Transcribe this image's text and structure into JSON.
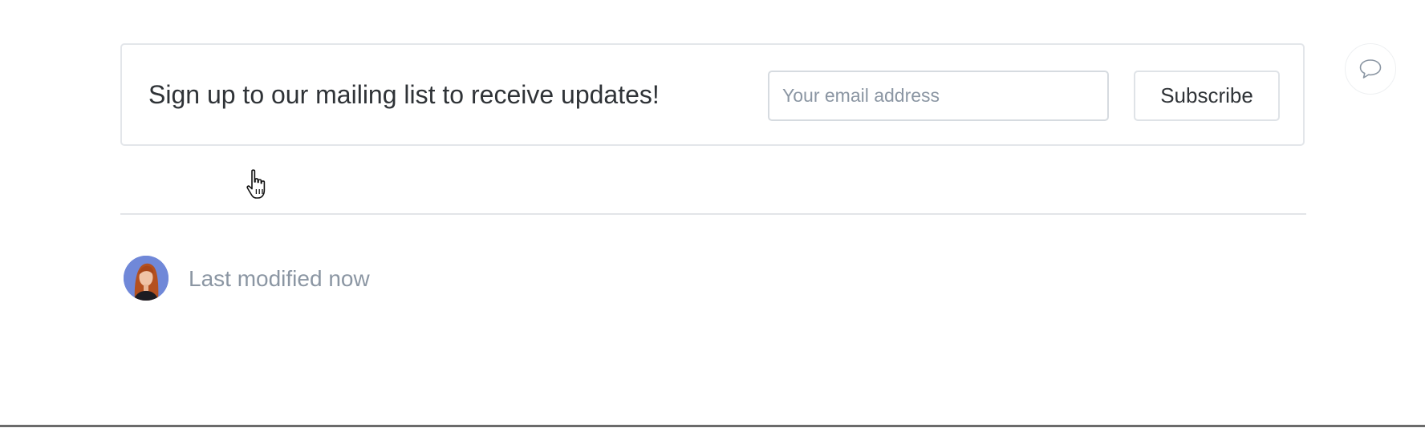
{
  "signup": {
    "heading": "Sign up to our mailing list to receive updates!",
    "email_placeholder": "Your email address",
    "email_value": "",
    "subscribe_label": "Subscribe"
  },
  "comment": {
    "icon": "speech-bubble-icon"
  },
  "footer": {
    "avatar_icon": "user-avatar",
    "modified_text": "Last modified now"
  },
  "cursor": {
    "icon": "hand-pointer-icon"
  },
  "colors": {
    "text": "#2f3337",
    "muted_text": "#8b96a3",
    "border": "#e3e6ea",
    "avatar_bg": "#6f86d6"
  }
}
